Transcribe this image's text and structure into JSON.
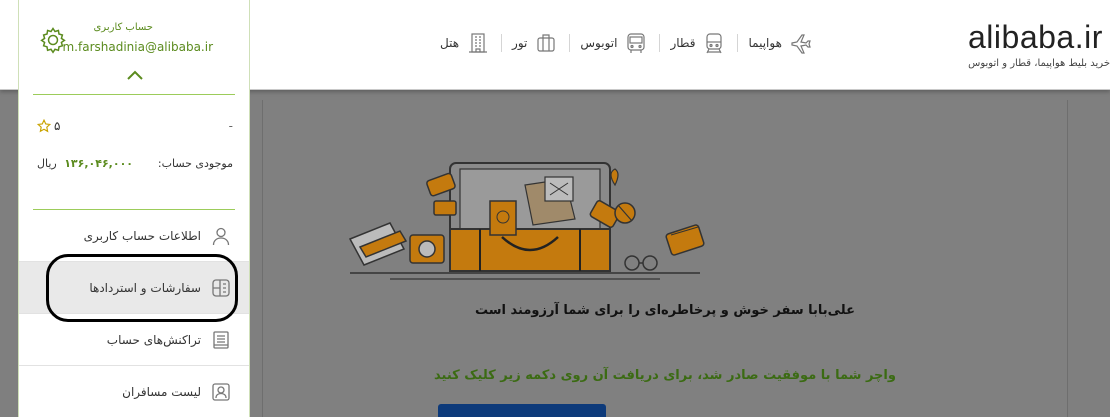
{
  "header": {
    "brand": "alibaba.ir",
    "tagline": "خرید بلیط هواپیما، قطار و اتوبوس",
    "nav": [
      {
        "label": "هواپیما",
        "icon": "airplane-icon"
      },
      {
        "label": "قطار",
        "icon": "train-icon"
      },
      {
        "label": "اتوبوس",
        "icon": "bus-icon"
      },
      {
        "label": "تور",
        "icon": "suitcase-icon"
      },
      {
        "label": "هتل",
        "icon": "hotel-icon"
      }
    ]
  },
  "account": {
    "label": "حساب کاربری",
    "email": "m.farshadinia@alibaba.ir",
    "rating": "۵",
    "dash": "-",
    "balance_label": "موجودی حساب:",
    "balance_value": "۱۳۶,۰۴۶,۰۰۰",
    "balance_unit": "ریال"
  },
  "menu": [
    {
      "label": "اطلاعات حساب کاربری",
      "icon": "user-icon"
    },
    {
      "label": "سفارشات و استردادها",
      "icon": "orders-icon"
    },
    {
      "label": "تراکنش‌های حساب",
      "icon": "receipt-icon"
    },
    {
      "label": "لیست مسافران",
      "icon": "passengers-icon"
    }
  ],
  "main": {
    "message": "علی‌بابا سفر خوش و پرخاطره‌ای را برای شما آرزومند است",
    "voucher_message": "واچر شما با موفقیت صادر شد، برای دریافت آن روی دکمه زیر کلیک کنید"
  },
  "colors": {
    "accent_green": "#5b8b1e",
    "illustration_orange": "#c47a0e",
    "button_blue": "#0d3a7a"
  }
}
